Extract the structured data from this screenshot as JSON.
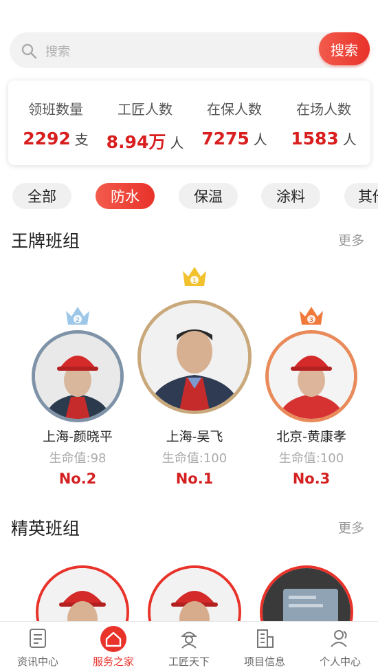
{
  "search": {
    "placeholder": "搜索",
    "button_label": "搜索"
  },
  "stats": [
    {
      "label": "领班数量",
      "value": "2292",
      "unit": "支"
    },
    {
      "label": "工匠人数",
      "value": "8.94万",
      "unit": "人"
    },
    {
      "label": "在保人数",
      "value": "7275",
      "unit": "人"
    },
    {
      "label": "在场人数",
      "value": "1583",
      "unit": "人"
    }
  ],
  "categories": [
    {
      "label": "全部",
      "active": false
    },
    {
      "label": "防水",
      "active": true
    },
    {
      "label": "保温",
      "active": false
    },
    {
      "label": "涂料",
      "active": false
    },
    {
      "label": "其他",
      "active": false
    }
  ],
  "ace_section": {
    "title": "王牌班组",
    "more": "更多"
  },
  "ace_teams": [
    {
      "name": "上海-颜晓平",
      "life": "生命值:98",
      "rank": "No.2",
      "crown_number": "2",
      "crown_color": "#9cc7e8",
      "ring_color": "#7f93a8"
    },
    {
      "name": "上海-吴飞",
      "life": "生命值:100",
      "rank": "No.1",
      "crown_number": "1",
      "crown_color": "#f2c12e",
      "ring_color": "#c9a97b"
    },
    {
      "name": "北京-黄康孝",
      "life": "生命值:100",
      "rank": "No.3",
      "crown_number": "3",
      "crown_color": "#f07a3c",
      "ring_color": "#e98a5a"
    }
  ],
  "elite_section": {
    "title": "精英班组",
    "more": "更多"
  },
  "bottom_nav": [
    {
      "label": "资讯中心",
      "icon": "document-icon",
      "active": false
    },
    {
      "label": "服务之家",
      "icon": "home-icon",
      "active": true
    },
    {
      "label": "工匠天下",
      "icon": "worker-icon",
      "active": false
    },
    {
      "label": "项目信息",
      "icon": "building-icon",
      "active": false
    },
    {
      "label": "个人中心",
      "icon": "user-icon",
      "active": false
    }
  ],
  "colors": {
    "accent": "#e8322a",
    "rank_text": "#d42020",
    "stat_number": "#d81e1e"
  }
}
